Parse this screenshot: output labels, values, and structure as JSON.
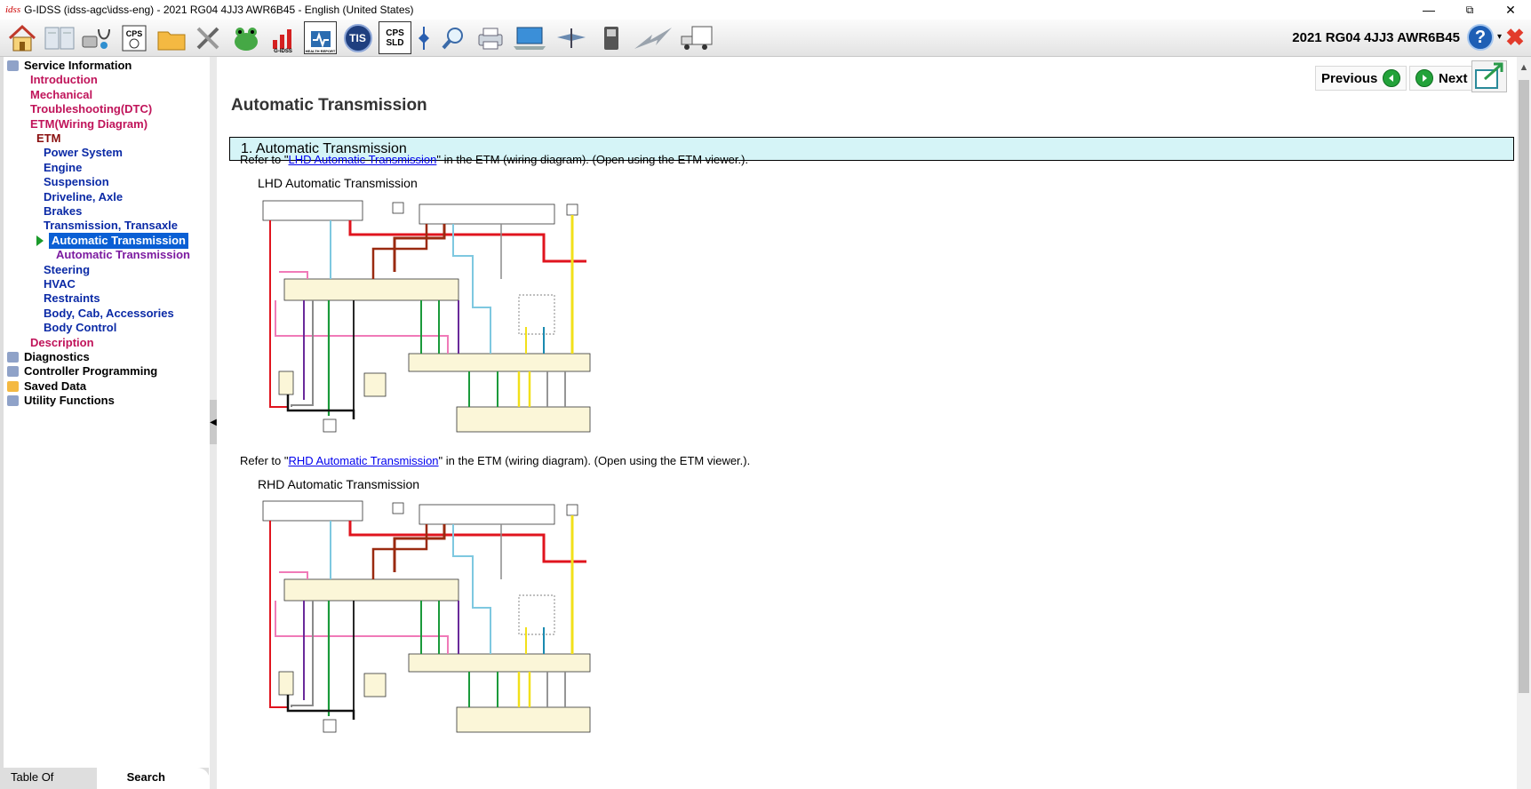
{
  "window": {
    "logo": "idss",
    "title": "G-IDSS (idss-agc\\idss-eng) - 2021 RG04 4JJ3 AWR6B45 - English (United States)",
    "minimize": "—",
    "restore": "⧉",
    "close": "✕"
  },
  "toolbar": {
    "buttons": [
      {
        "name": "home-icon"
      },
      {
        "name": "book-icon"
      },
      {
        "name": "diagnostics-stethoscope-icon"
      },
      {
        "name": "cps-icon",
        "label": "CPS"
      },
      {
        "name": "folder-icon"
      },
      {
        "name": "tools-icon"
      },
      {
        "name": "frog-icon"
      },
      {
        "name": "g-idss-chart-icon",
        "label": "G-IDSS"
      },
      {
        "name": "health-report-icon",
        "label": "HEALTH REPORT"
      },
      {
        "name": "tis-icon",
        "label": "TIS"
      },
      {
        "name": "cps-sld-icon",
        "label": "CPS SLD"
      },
      {
        "name": "marker-icon"
      },
      {
        "name": "magnifier-icon"
      },
      {
        "name": "printer-icon"
      },
      {
        "name": "laptop-icon"
      },
      {
        "name": "satellite-icon"
      },
      {
        "name": "device-icon"
      },
      {
        "name": "signal-icon"
      },
      {
        "name": "truck-icon"
      }
    ],
    "vehicle": "2021 RG04 4JJ3 AWR6B45",
    "help_label": "?",
    "help_dropdown": "▾",
    "exit_label": "✖"
  },
  "sidebar": {
    "tree": [
      {
        "label": "Service Information",
        "style": "c-top",
        "indent": 22,
        "icon": "book-icon"
      },
      {
        "label": "Introduction",
        "style": "c-red",
        "indent": 30
      },
      {
        "label": "Mechanical",
        "style": "c-red",
        "indent": 30
      },
      {
        "label": "Troubleshooting(DTC)",
        "style": "c-red",
        "indent": 30
      },
      {
        "label": "ETM(Wiring Diagram)",
        "style": "c-red",
        "indent": 30
      },
      {
        "label": "ETM",
        "style": "c-maroon",
        "indent": 37
      },
      {
        "label": "Power System",
        "style": "c-blue",
        "indent": 45
      },
      {
        "label": "Engine",
        "style": "c-blue",
        "indent": 45
      },
      {
        "label": "Suspension",
        "style": "c-blue",
        "indent": 45
      },
      {
        "label": "Driveline, Axle",
        "style": "c-blue",
        "indent": 45
      },
      {
        "label": "Brakes",
        "style": "c-blue",
        "indent": 45
      },
      {
        "label": "Transmission, Transaxle",
        "style": "c-blue",
        "indent": 45
      },
      {
        "label": "Automatic Transmission",
        "style": "sel",
        "indent": 51,
        "selected": true
      },
      {
        "label": "Automatic Transmission",
        "style": "c-purple",
        "indent": 59
      },
      {
        "label": "Steering",
        "style": "c-blue",
        "indent": 45
      },
      {
        "label": "HVAC",
        "style": "c-blue",
        "indent": 45
      },
      {
        "label": "Restraints",
        "style": "c-blue",
        "indent": 45
      },
      {
        "label": "Body, Cab, Accessories",
        "style": "c-blue",
        "indent": 45
      },
      {
        "label": "Body Control",
        "style": "c-blue",
        "indent": 45
      },
      {
        "label": "Description",
        "style": "c-red",
        "indent": 30
      },
      {
        "label": "Diagnostics",
        "style": "c-top",
        "indent": 22,
        "icon": "diagnostics-icon"
      },
      {
        "label": "Controller Programming",
        "style": "c-top",
        "indent": 22,
        "icon": "programming-icon"
      },
      {
        "label": "Saved Data",
        "style": "c-top",
        "indent": 22,
        "icon": "saved-data-icon"
      },
      {
        "label": "Utility Functions",
        "style": "c-top",
        "indent": 22,
        "icon": "utility-icon"
      }
    ],
    "tabs": {
      "toc": "Table Of Contents",
      "search": "Search"
    },
    "collapse_glyph": "◀"
  },
  "content": {
    "previous_label": "Previous",
    "next_label": "Next",
    "title": "Automatic Transmission",
    "section": "1. Automatic Transmission",
    "refs": [
      {
        "prefix": "Refer to \"",
        "link": "LHD Automatic Transmission",
        "suffix": "\" in the ETM (wiring diagram). (Open using the ETM viewer.).",
        "figure_label": "LHD Automatic Transmission"
      },
      {
        "prefix": "Refer to \"",
        "link": "RHD Automatic Transmission",
        "suffix": "\" in the ETM (wiring diagram). (Open using the ETM viewer.).",
        "figure_label": "RHD Automatic Transmission"
      }
    ]
  },
  "scrollbar": {
    "up": "▲"
  },
  "colors": {
    "selection": "#0a5fd4",
    "section_bg": "#d5f4f7",
    "wire_red": "#e0141e",
    "wire_brown": "#9a2a10",
    "wire_lightblue": "#7ec8e0",
    "wire_yellow": "#f2e01a",
    "wire_pink": "#f07ab8",
    "wire_green": "#1a9a3a",
    "wire_purple": "#6a2a9a",
    "wire_gray": "#8a8a8a",
    "wire_black": "#111111"
  }
}
